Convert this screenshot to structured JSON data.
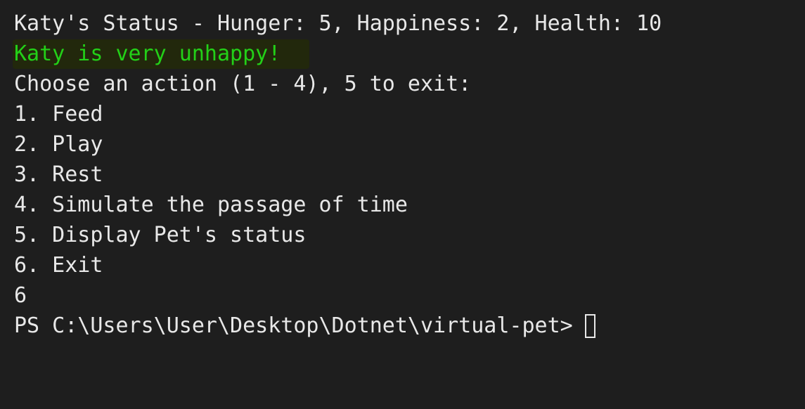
{
  "terminal": {
    "status_line": "Katy's Status - Hunger: 5, Happiness: 2, Health: 10",
    "warning_line": "Katy is very unhappy!",
    "prompt_choose": "Choose an action (1 - 4), 5 to exit:",
    "menu": [
      "1. Feed",
      "2. Play",
      "3. Rest",
      "4. Simulate the passage of time",
      "5. Display Pet's status",
      "6. Exit"
    ],
    "user_input": "6",
    "shell_prompt": "PS C:\\Users\\User\\Desktop\\Dotnet\\virtual-pet>",
    "colors": {
      "background": "#1e1e1e",
      "text": "#e8e8e8",
      "warning": "#23d018",
      "warning_highlight": "#22280c"
    }
  }
}
